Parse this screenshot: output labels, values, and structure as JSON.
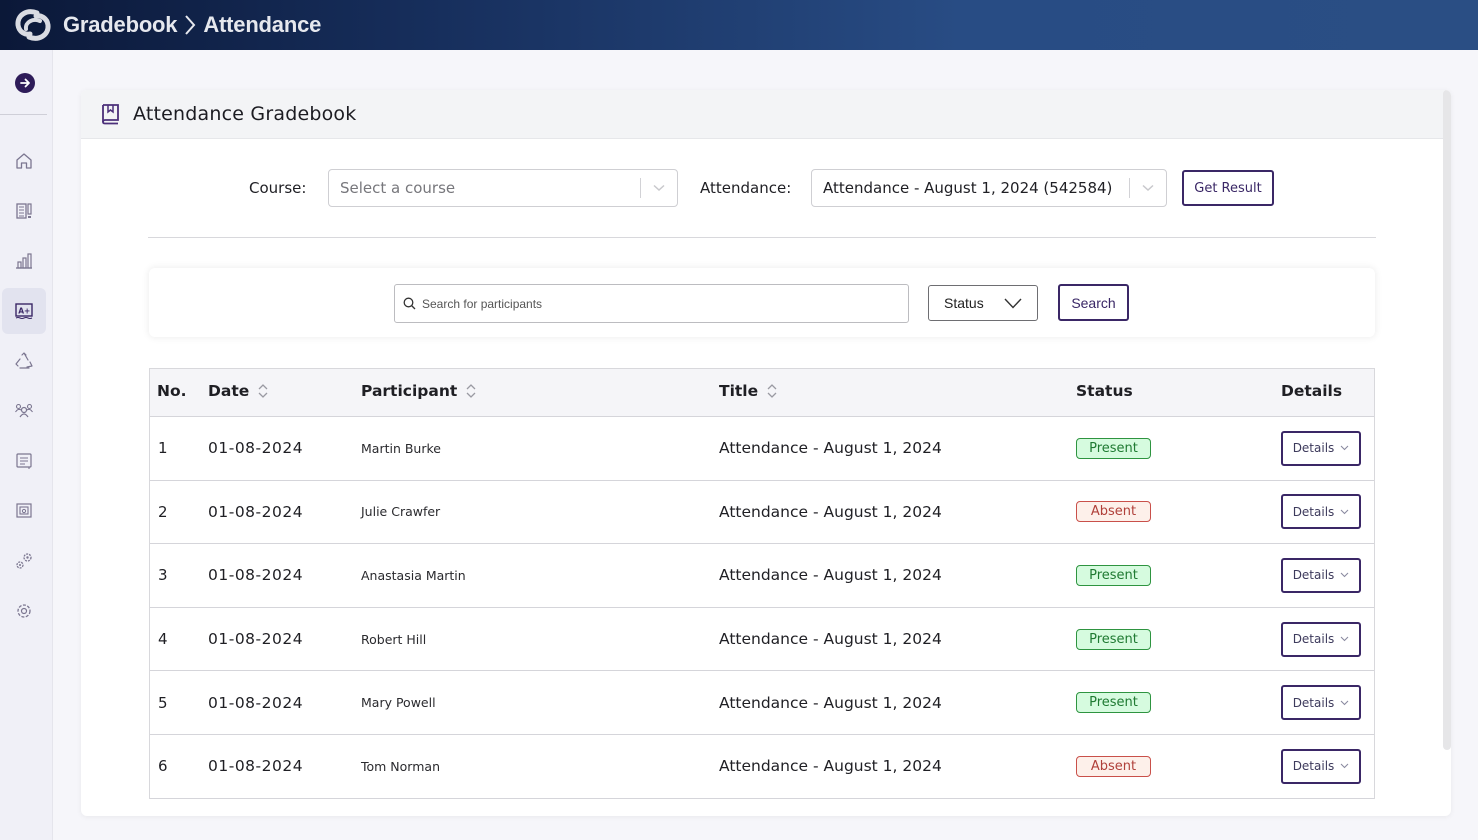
{
  "topbar": {
    "logo_icon": "brand-logo",
    "breadcrumb": [
      "Gradebook",
      "Attendance"
    ],
    "gradient_colors": [
      "#0b1838",
      "#2a4e84"
    ]
  },
  "sidebar": {
    "expand_icon": "arrow-right-circle",
    "items": [
      {
        "icon": "home",
        "label": "Home",
        "active": false
      },
      {
        "icon": "report",
        "label": "Reports",
        "active": false
      },
      {
        "icon": "bar-chart",
        "label": "Analytics",
        "active": false
      },
      {
        "icon": "grade-a-plus",
        "label": "Gradebook",
        "active": true
      },
      {
        "icon": "recycle",
        "label": "Recycle",
        "active": false
      },
      {
        "icon": "users-group",
        "label": "Users",
        "active": false
      },
      {
        "icon": "list-document",
        "label": "Lists",
        "active": false
      },
      {
        "icon": "classroom",
        "label": "Classroom",
        "active": false
      },
      {
        "icon": "gears",
        "label": "Integrations",
        "active": false
      },
      {
        "icon": "settings",
        "label": "Settings",
        "active": false
      }
    ]
  },
  "card": {
    "icon": "book-bookmark",
    "title": "Attendance Gradebook"
  },
  "filters": {
    "course_label": "Course:",
    "course_placeholder": "Select a course",
    "attendance_label": "Attendance:",
    "attendance_value": "Attendance - August 1, 2024 (542584)",
    "get_result_label": "Get Result"
  },
  "search": {
    "placeholder": "Search for participants",
    "value": "",
    "status_label": "Status",
    "search_label": "Search"
  },
  "table": {
    "columns": [
      {
        "label": "No.",
        "sortable": false
      },
      {
        "label": "Date",
        "sortable": true
      },
      {
        "label": "Participant",
        "sortable": true
      },
      {
        "label": "Title",
        "sortable": true
      },
      {
        "label": "Status",
        "sortable": false
      },
      {
        "label": "Details",
        "sortable": false
      }
    ],
    "rows": [
      {
        "no": "1",
        "date": "01-08-2024",
        "participant": "Martin Burke",
        "title": "Attendance - August 1, 2024",
        "status": "Present",
        "details": "Details"
      },
      {
        "no": "2",
        "date": "01-08-2024",
        "participant": "Julie Crawfer",
        "title": "Attendance - August 1, 2024",
        "status": "Absent",
        "details": "Details"
      },
      {
        "no": "3",
        "date": "01-08-2024",
        "participant": "Anastasia Martin",
        "title": "Attendance - August 1, 2024",
        "status": "Present",
        "details": "Details"
      },
      {
        "no": "4",
        "date": "01-08-2024",
        "participant": "Robert Hill",
        "title": "Attendance - August 1, 2024",
        "status": "Present",
        "details": "Details"
      },
      {
        "no": "5",
        "date": "01-08-2024",
        "participant": "Mary Powell",
        "title": "Attendance - August 1, 2024",
        "status": "Present",
        "details": "Details"
      },
      {
        "no": "6",
        "date": "01-08-2024",
        "participant": "Tom Norman",
        "title": "Attendance - August 1, 2024",
        "status": "Absent",
        "details": "Details"
      }
    ]
  },
  "colors": {
    "accent": "#3a2766",
    "present_bg": "#d6fbdf",
    "present_border": "#2e9440",
    "absent_bg": "#fdf0ea",
    "absent_border": "#c9504a"
  }
}
